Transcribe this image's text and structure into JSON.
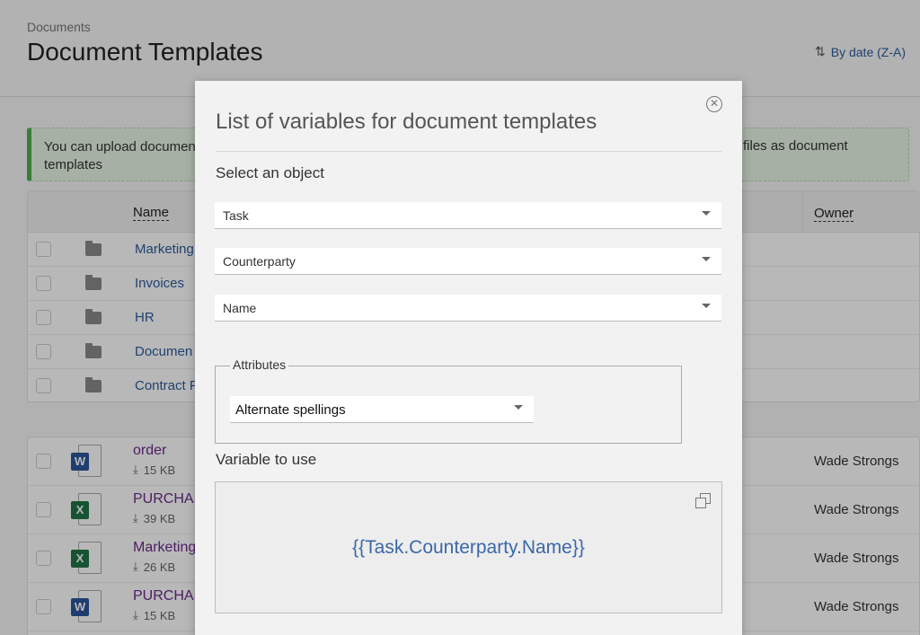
{
  "page": {
    "breadcrumb": "Documents",
    "title": "Document Templates",
    "sort_label": "By date (Z-A)",
    "sort_icon": "sort-icon"
  },
  "banner": {
    "text_left": "You can upload documen templates",
    "text_right": "files as document"
  },
  "folders": {
    "name_header": "Name",
    "owner_header": "Owner",
    "items": [
      {
        "label": "Marketing"
      },
      {
        "label": "Invoices"
      },
      {
        "label": "HR"
      },
      {
        "label": "Documen"
      },
      {
        "label": "Contract F"
      }
    ]
  },
  "files": [
    {
      "name": "order",
      "size": "15 KB",
      "type": "W",
      "owner": "Wade Strongs"
    },
    {
      "name": "PURCHAS",
      "size": "39 KB",
      "type": "X",
      "owner": "Wade Strongs"
    },
    {
      "name": "Marketing",
      "size": "26 KB",
      "type": "X",
      "owner": "Wade Strongs"
    },
    {
      "name": "PURCHAS",
      "size": "15 KB",
      "type": "W",
      "owner": "Wade Strongs"
    }
  ],
  "modal": {
    "title": "List of variables for document templates",
    "close_icon": "close-icon",
    "select_label": "Select an object",
    "dropdowns": [
      {
        "value": "Task"
      },
      {
        "value": "Counterparty"
      },
      {
        "value": "Name"
      }
    ],
    "attributes_legend": "Attributes",
    "attribute_value": "Alternate spellings",
    "variable_label": "Variable to use",
    "variable_value": "{{Task.Counterparty.Name}}",
    "copy_icon": "copy-icon"
  },
  "colors": {
    "link": "#2b5b9c",
    "visited_link": "#6b2a8a",
    "variable": "#3a68a8",
    "banner_accent": "#4caf50",
    "word": "#2b579a",
    "excel": "#217346"
  }
}
